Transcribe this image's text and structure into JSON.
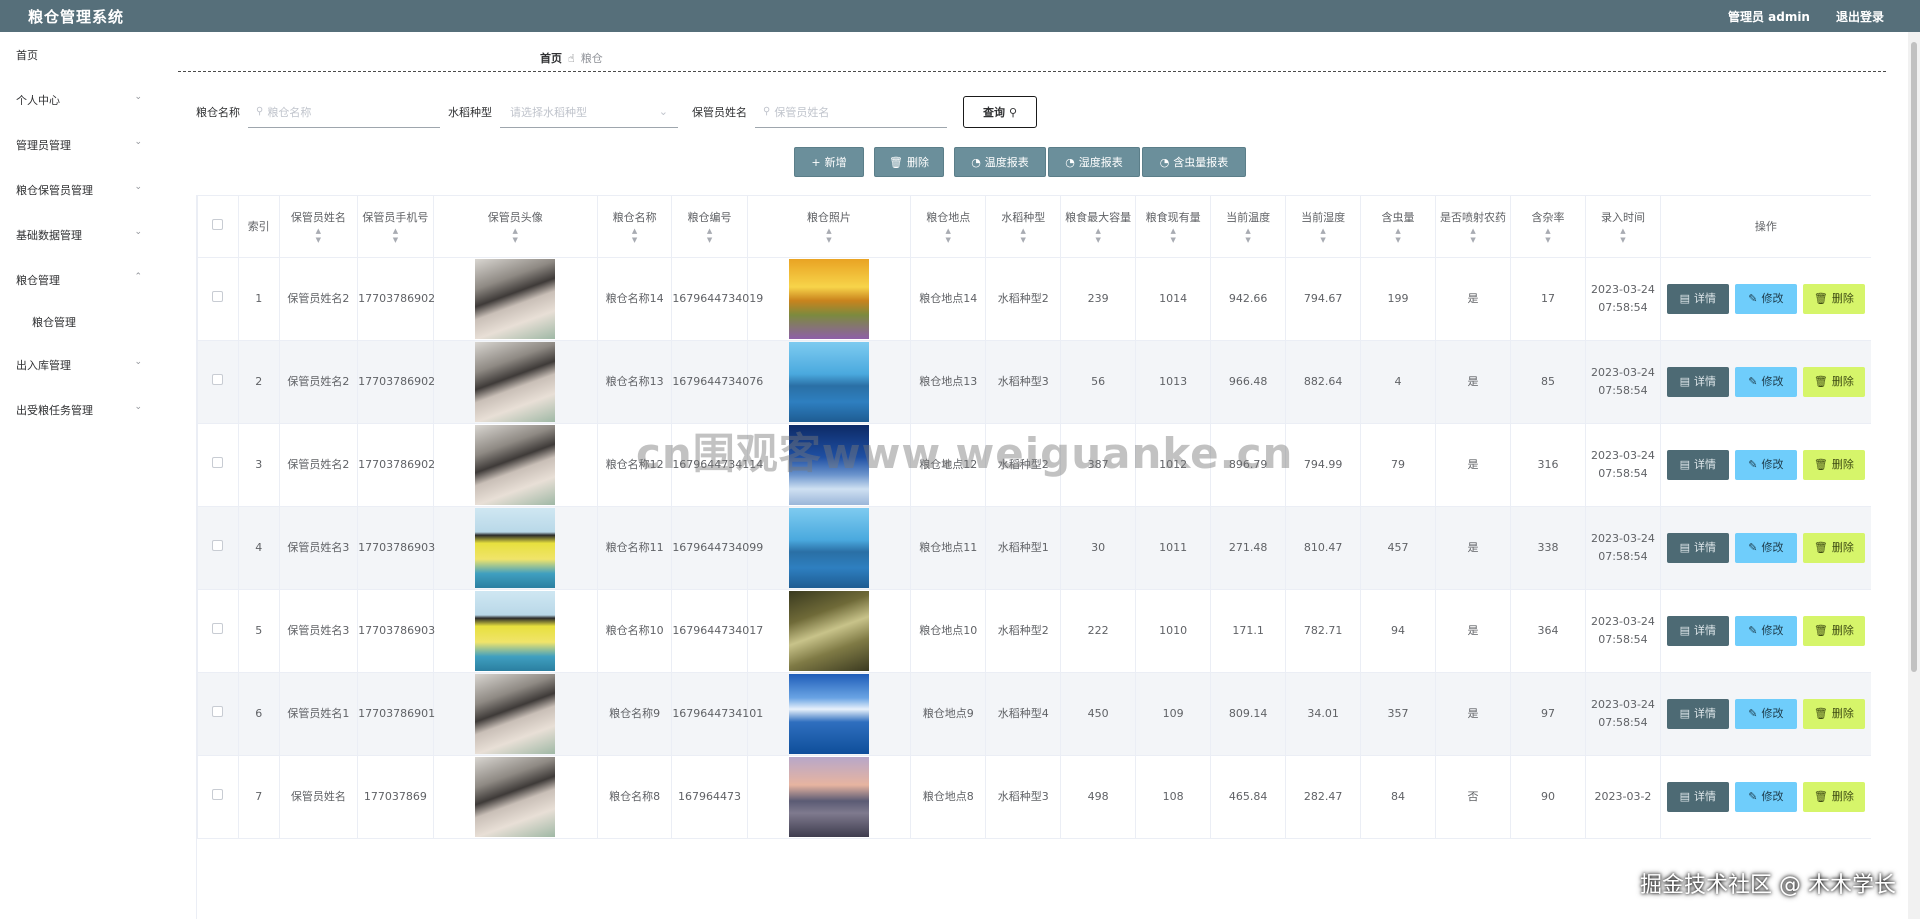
{
  "header": {
    "title": "粮仓管理系统",
    "admin": "管理员 admin",
    "logout": "退出登录"
  },
  "sidebar": {
    "items": [
      {
        "label": "首页",
        "chevron": false
      },
      {
        "label": "个人中心",
        "chevron": true
      },
      {
        "label": "管理员管理",
        "chevron": true
      },
      {
        "label": "粮仓保管员管理",
        "chevron": true
      },
      {
        "label": "基础数据管理",
        "chevron": true
      },
      {
        "label": "粮仓管理",
        "chevron": true
      },
      {
        "label": "粮仓管理",
        "sub": true
      },
      {
        "label": "出入库管理",
        "chevron": true
      },
      {
        "label": "出受粮任务管理",
        "chevron": true
      }
    ]
  },
  "breadcrumb": {
    "home": "首页",
    "current": "粮仓"
  },
  "filters": {
    "name_label": "粮仓名称",
    "name_placeholder": "粮仓名称",
    "type_label": "水稻种型",
    "type_placeholder": "请选择水稻种型",
    "keeper_label": "保管员姓名",
    "keeper_placeholder": "保管员姓名",
    "search": "查询"
  },
  "toolbar": {
    "add": "新增",
    "delete": "删除",
    "temp_report": "温度报表",
    "humidity_report": "湿度报表",
    "pest_report": "含虫量报表"
  },
  "table": {
    "headers": [
      "索引",
      "保管员姓名",
      "保管员手机号",
      "保管员头像",
      "粮仓名称",
      "粮仓编号",
      "粮仓照片",
      "粮仓地点",
      "水稻种型",
      "粮食最大容量",
      "粮食现有量",
      "当前温度",
      "当前湿度",
      "含虫量",
      "是否喷射农药",
      "含杂率",
      "录入时间",
      "操作"
    ],
    "ops": {
      "detail": "详情",
      "edit": "修改",
      "delete": "删除"
    },
    "rows": [
      {
        "idx": "1",
        "keeper": "保管员姓名2",
        "phone": "17703786902",
        "avatar": "a",
        "name": "粮仓名称14",
        "code": "1679644734019",
        "photo": "sunset",
        "place": "粮仓地点14",
        "rice": "水稻种型2",
        "max": "239",
        "cur": "1014",
        "temp": "942.66",
        "hum": "794.67",
        "pest": "199",
        "spray": "是",
        "impurity": "17",
        "time": "2023-03-24 07:58:54"
      },
      {
        "idx": "2",
        "keeper": "保管员姓名2",
        "phone": "17703786902",
        "avatar": "a",
        "name": "粮仓名称13",
        "code": "1679644734076",
        "photo": "lake",
        "place": "粮仓地点13",
        "rice": "水稻种型3",
        "max": "56",
        "cur": "1013",
        "temp": "966.48",
        "hum": "882.64",
        "pest": "4",
        "spray": "是",
        "impurity": "85",
        "time": "2023-03-24 07:58:54"
      },
      {
        "idx": "3",
        "keeper": "保管员姓名2",
        "phone": "17703786902",
        "avatar": "a",
        "name": "粮仓名称12",
        "code": "1679644734114",
        "photo": "snow",
        "place": "粮仓地点12",
        "rice": "水稻种型2",
        "max": "387",
        "cur": "1012",
        "temp": "896.79",
        "hum": "794.99",
        "pest": "79",
        "spray": "是",
        "impurity": "316",
        "time": "2023-03-24 07:58:54"
      },
      {
        "idx": "4",
        "keeper": "保管员姓名3",
        "phone": "17703786903",
        "avatar": "b",
        "name": "粮仓名称11",
        "code": "1679644734099",
        "photo": "lake",
        "place": "粮仓地点11",
        "rice": "水稻种型1",
        "max": "30",
        "cur": "1011",
        "temp": "271.48",
        "hum": "810.47",
        "pest": "457",
        "spray": "是",
        "impurity": "338",
        "time": "2023-03-24 07:58:54"
      },
      {
        "idx": "5",
        "keeper": "保管员姓名3",
        "phone": "17703786903",
        "avatar": "b",
        "name": "粮仓名称10",
        "code": "1679644734017",
        "photo": "forest",
        "place": "粮仓地点10",
        "rice": "水稻种型2",
        "max": "222",
        "cur": "1010",
        "temp": "171.1",
        "hum": "782.71",
        "pest": "94",
        "spray": "是",
        "impurity": "364",
        "time": "2023-03-24 07:58:54"
      },
      {
        "idx": "6",
        "keeper": "保管员姓名1",
        "phone": "17703786901",
        "avatar": "a",
        "name": "粮仓名称9",
        "code": "1679644734101",
        "photo": "sea",
        "place": "粮仓地点9",
        "rice": "水稻种型4",
        "max": "450",
        "cur": "109",
        "temp": "809.14",
        "hum": "34.01",
        "pest": "357",
        "spray": "是",
        "impurity": "97",
        "time": "2023-03-24 07:58:54"
      },
      {
        "idx": "7",
        "keeper": "保管员姓名",
        "phone": "177037869",
        "avatar": "a",
        "name": "粮仓名称8",
        "code": "167964473",
        "photo": "fuji",
        "place": "粮仓地点8",
        "rice": "水稻种型3",
        "max": "498",
        "cur": "108",
        "temp": "465.84",
        "hum": "282.47",
        "pest": "84",
        "spray": "否",
        "impurity": "90",
        "time": "2023-03-2"
      }
    ]
  },
  "watermark": "cn围观客www.weiguanke.cn",
  "corner_mark": "掘金技术社区 @ 木木学长"
}
